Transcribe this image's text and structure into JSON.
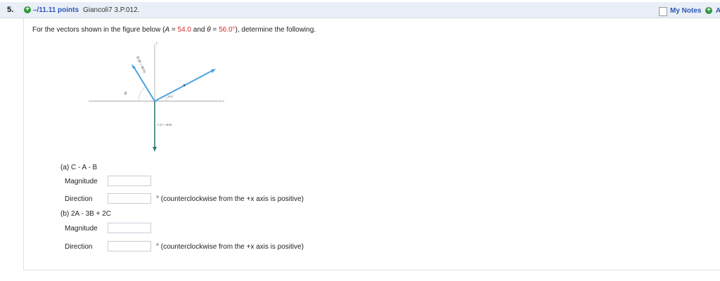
{
  "header": {
    "question_number": "5.",
    "points": "–/11.11 points",
    "source": "Giancoli7 3.P.012.",
    "my_notes": "My Notes",
    "ask": "A"
  },
  "problem": {
    "intro": "For the vectors shown in the figure below (",
    "a_sym": "A",
    "eq1": " = ",
    "a_val": "54.0",
    "and": " and ",
    "theta_sym": "θ",
    "eq2": " = ",
    "theta_val": "56.0°",
    "outro": "), determine the following."
  },
  "figure": {
    "y_label": "y",
    "x_label": "x",
    "b_label": "B (B = 40.0)",
    "a_label": "A",
    "angle_28": "28.0°",
    "theta_label": "θ",
    "c_label": "C (C = 46.8)"
  },
  "parts": [
    {
      "label": "(a) C - A - B",
      "magnitude_label": "Magnitude",
      "direction_label": "Direction",
      "direction_note": "° (counterclockwise from the +x axis is positive)"
    },
    {
      "label": "(b) 2A - 3B + 2C",
      "magnitude_label": "Magnitude",
      "direction_label": "Direction",
      "direction_note": "° (counterclockwise from the +x axis is positive)"
    }
  ],
  "colors": {
    "accent_blue": "#2a58b5",
    "highlight_red": "#d42a2a",
    "vector_blue": "#4aa3e0",
    "vector_green": "#2f7d73"
  }
}
